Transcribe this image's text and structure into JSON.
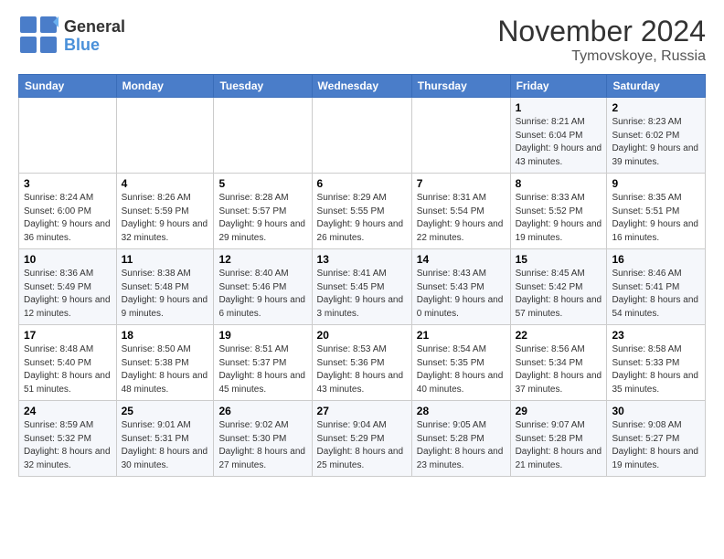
{
  "logo": {
    "general": "General",
    "blue": "Blue"
  },
  "title": {
    "month": "November 2024",
    "location": "Tymovskoye, Russia"
  },
  "header": {
    "days": [
      "Sunday",
      "Monday",
      "Tuesday",
      "Wednesday",
      "Thursday",
      "Friday",
      "Saturday"
    ]
  },
  "weeks": [
    [
      {
        "day": "",
        "info": ""
      },
      {
        "day": "",
        "info": ""
      },
      {
        "day": "",
        "info": ""
      },
      {
        "day": "",
        "info": ""
      },
      {
        "day": "",
        "info": ""
      },
      {
        "day": "1",
        "info": "Sunrise: 8:21 AM\nSunset: 6:04 PM\nDaylight: 9 hours and 43 minutes."
      },
      {
        "day": "2",
        "info": "Sunrise: 8:23 AM\nSunset: 6:02 PM\nDaylight: 9 hours and 39 minutes."
      }
    ],
    [
      {
        "day": "3",
        "info": "Sunrise: 8:24 AM\nSunset: 6:00 PM\nDaylight: 9 hours and 36 minutes."
      },
      {
        "day": "4",
        "info": "Sunrise: 8:26 AM\nSunset: 5:59 PM\nDaylight: 9 hours and 32 minutes."
      },
      {
        "day": "5",
        "info": "Sunrise: 8:28 AM\nSunset: 5:57 PM\nDaylight: 9 hours and 29 minutes."
      },
      {
        "day": "6",
        "info": "Sunrise: 8:29 AM\nSunset: 5:55 PM\nDaylight: 9 hours and 26 minutes."
      },
      {
        "day": "7",
        "info": "Sunrise: 8:31 AM\nSunset: 5:54 PM\nDaylight: 9 hours and 22 minutes."
      },
      {
        "day": "8",
        "info": "Sunrise: 8:33 AM\nSunset: 5:52 PM\nDaylight: 9 hours and 19 minutes."
      },
      {
        "day": "9",
        "info": "Sunrise: 8:35 AM\nSunset: 5:51 PM\nDaylight: 9 hours and 16 minutes."
      }
    ],
    [
      {
        "day": "10",
        "info": "Sunrise: 8:36 AM\nSunset: 5:49 PM\nDaylight: 9 hours and 12 minutes."
      },
      {
        "day": "11",
        "info": "Sunrise: 8:38 AM\nSunset: 5:48 PM\nDaylight: 9 hours and 9 minutes."
      },
      {
        "day": "12",
        "info": "Sunrise: 8:40 AM\nSunset: 5:46 PM\nDaylight: 9 hours and 6 minutes."
      },
      {
        "day": "13",
        "info": "Sunrise: 8:41 AM\nSunset: 5:45 PM\nDaylight: 9 hours and 3 minutes."
      },
      {
        "day": "14",
        "info": "Sunrise: 8:43 AM\nSunset: 5:43 PM\nDaylight: 9 hours and 0 minutes."
      },
      {
        "day": "15",
        "info": "Sunrise: 8:45 AM\nSunset: 5:42 PM\nDaylight: 8 hours and 57 minutes."
      },
      {
        "day": "16",
        "info": "Sunrise: 8:46 AM\nSunset: 5:41 PM\nDaylight: 8 hours and 54 minutes."
      }
    ],
    [
      {
        "day": "17",
        "info": "Sunrise: 8:48 AM\nSunset: 5:40 PM\nDaylight: 8 hours and 51 minutes."
      },
      {
        "day": "18",
        "info": "Sunrise: 8:50 AM\nSunset: 5:38 PM\nDaylight: 8 hours and 48 minutes."
      },
      {
        "day": "19",
        "info": "Sunrise: 8:51 AM\nSunset: 5:37 PM\nDaylight: 8 hours and 45 minutes."
      },
      {
        "day": "20",
        "info": "Sunrise: 8:53 AM\nSunset: 5:36 PM\nDaylight: 8 hours and 43 minutes."
      },
      {
        "day": "21",
        "info": "Sunrise: 8:54 AM\nSunset: 5:35 PM\nDaylight: 8 hours and 40 minutes."
      },
      {
        "day": "22",
        "info": "Sunrise: 8:56 AM\nSunset: 5:34 PM\nDaylight: 8 hours and 37 minutes."
      },
      {
        "day": "23",
        "info": "Sunrise: 8:58 AM\nSunset: 5:33 PM\nDaylight: 8 hours and 35 minutes."
      }
    ],
    [
      {
        "day": "24",
        "info": "Sunrise: 8:59 AM\nSunset: 5:32 PM\nDaylight: 8 hours and 32 minutes."
      },
      {
        "day": "25",
        "info": "Sunrise: 9:01 AM\nSunset: 5:31 PM\nDaylight: 8 hours and 30 minutes."
      },
      {
        "day": "26",
        "info": "Sunrise: 9:02 AM\nSunset: 5:30 PM\nDaylight: 8 hours and 27 minutes."
      },
      {
        "day": "27",
        "info": "Sunrise: 9:04 AM\nSunset: 5:29 PM\nDaylight: 8 hours and 25 minutes."
      },
      {
        "day": "28",
        "info": "Sunrise: 9:05 AM\nSunset: 5:28 PM\nDaylight: 8 hours and 23 minutes."
      },
      {
        "day": "29",
        "info": "Sunrise: 9:07 AM\nSunset: 5:28 PM\nDaylight: 8 hours and 21 minutes."
      },
      {
        "day": "30",
        "info": "Sunrise: 9:08 AM\nSunset: 5:27 PM\nDaylight: 8 hours and 19 minutes."
      }
    ]
  ]
}
